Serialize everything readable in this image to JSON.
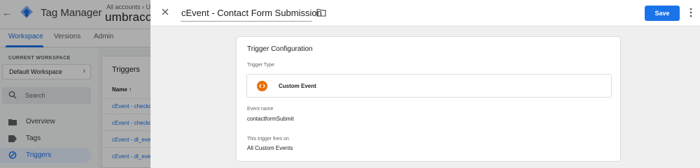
{
  "app": {
    "product_name": "Tag Manager",
    "accounts_breadcrumb": "All accounts › Umb",
    "account_name": "umbraco.c"
  },
  "tabs": [
    {
      "label": "Workspace",
      "active": true
    },
    {
      "label": "Versions",
      "active": false
    },
    {
      "label": "Admin",
      "active": false
    }
  ],
  "sidebar": {
    "current_workspace_label": "CURRENT WORKSPACE",
    "workspace_name": "Default Workspace",
    "search_placeholder": "Search",
    "nav": [
      {
        "label": "Overview",
        "icon": "folder-icon",
        "active": false
      },
      {
        "label": "Tags",
        "icon": "tag-icon",
        "active": false
      },
      {
        "label": "Triggers",
        "icon": "trigger-icon",
        "active": true
      }
    ]
  },
  "triggers_list": {
    "title": "Triggers",
    "column_header": "Name ↑",
    "rows": [
      "cEvent - checko",
      "cEvent - checko",
      "cEvent - dl_even",
      "cEvent - dl_even"
    ]
  },
  "editor": {
    "trigger_name": "cEvent - Contact Form Submission",
    "save_label": "Save",
    "card_title": "Trigger Configuration",
    "trigger_type_label": "Trigger Type",
    "trigger_type_value": "Custom Event",
    "trigger_type_icon": "code-icon",
    "event_name_label": "Event name",
    "event_name_value": "contactformSubmit",
    "fires_on_label": "This trigger fires on",
    "fires_on_value": "All Custom Events"
  },
  "colors": {
    "accent": "#1a73e8",
    "custom_event_icon": "#e8710a"
  }
}
